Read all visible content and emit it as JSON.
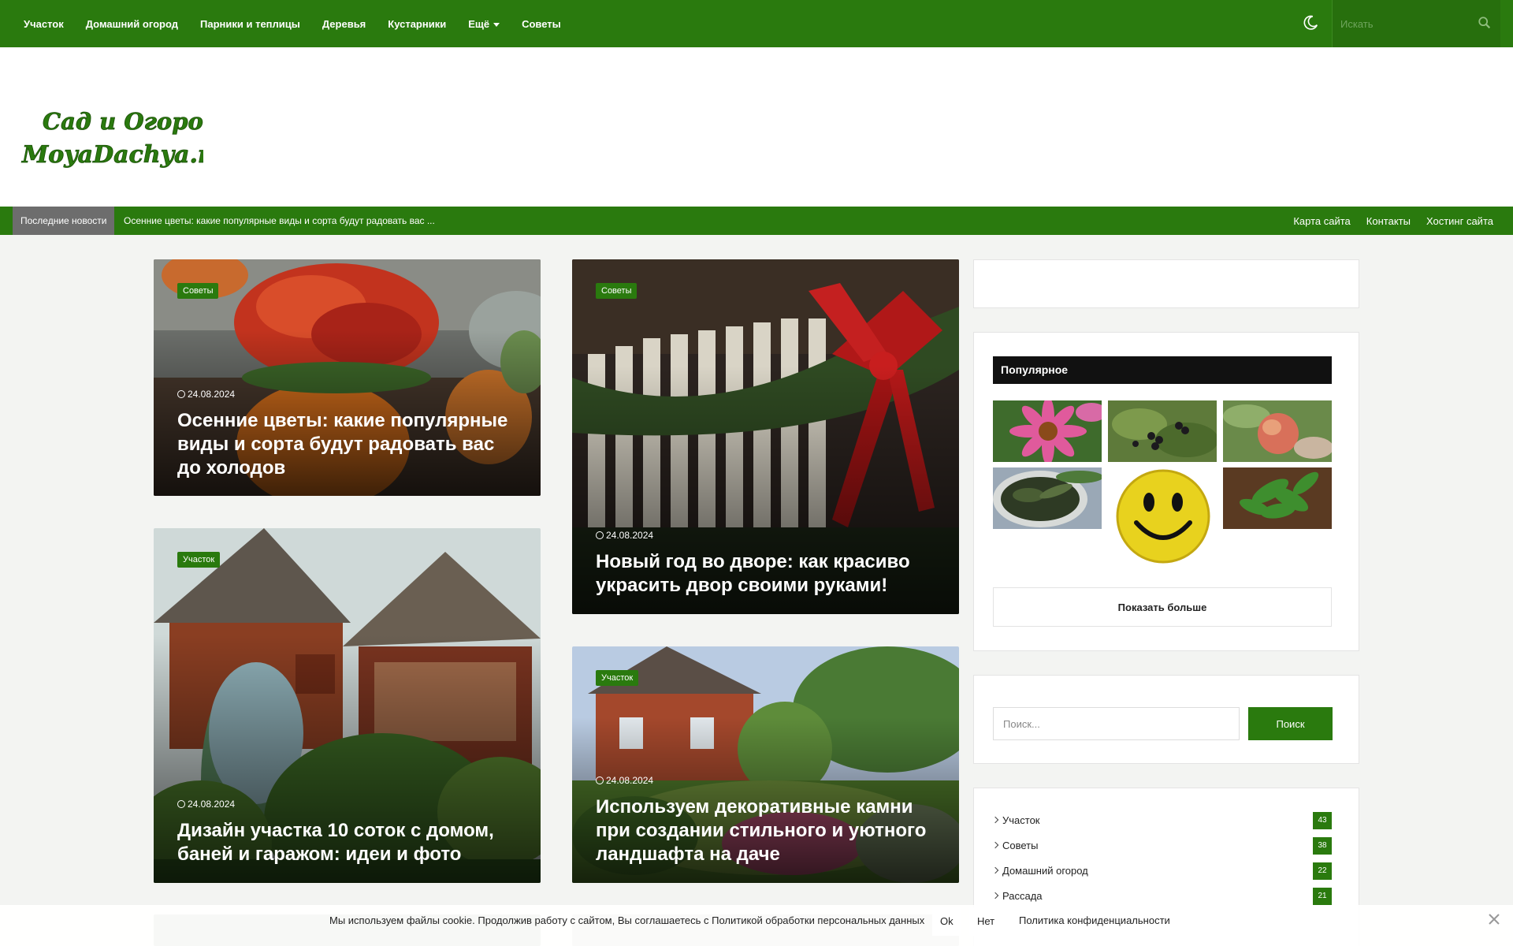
{
  "nav": {
    "items": [
      "Участок",
      "Домашний огород",
      "Парники и теплицы",
      "Деревья",
      "Кустарники",
      "Ещё",
      "Советы"
    ],
    "search_placeholder": "Искать",
    "icons": [
      "moon-icon",
      "search-icon",
      "caret-down-icon"
    ]
  },
  "logo": {
    "line1": "Сад и Огород",
    "line2": "MoyaDachya.ru"
  },
  "ticker": {
    "label": "Последние новости",
    "headline": "Осенние цветы: какие популярные виды и сорта будут радовать вас ...",
    "links": [
      "Карта сайта",
      "Контакты",
      "Хостинг сайта"
    ]
  },
  "posts": [
    {
      "category": "Советы",
      "date": "24.08.2024",
      "title": "Осенние цветы: какие популярные виды и сорта будут радовать вас до холодов"
    },
    {
      "category": "Советы",
      "date": "24.08.2024",
      "title": "Новый год во дворе: как красиво украсить двор своими руками!"
    },
    {
      "category": "Участок",
      "date": "24.08.2024",
      "title": "Дизайн участка 10 соток с домом, баней и гаражом: идеи и фото"
    },
    {
      "category": "Участок",
      "date": "24.08.2024",
      "title": "Используем декоративные камни при создании стильного и уютного ландшафта на даче"
    }
  ],
  "sidebar": {
    "popular_title": "Популярное",
    "more_button": "Показать больше",
    "search": {
      "placeholder": "Поиск...",
      "button": "Поиск"
    },
    "categories": [
      {
        "name": "Участок",
        "count": "43"
      },
      {
        "name": "Советы",
        "count": "38"
      },
      {
        "name": "Домашний огород",
        "count": "22"
      },
      {
        "name": "Рассада",
        "count": "21"
      }
    ]
  },
  "cookie": {
    "text": "Мы используем файлы cookie. Продолжив работу с сайтом, Вы соглашаетесь с Политикой обработки персональных данных",
    "ok": "Ok",
    "no": "Нет",
    "policy": "Политика конфиденциальности"
  },
  "colors": {
    "brand_green": "#2a7a0e",
    "popular_header": "#111111",
    "ticker_label": "#6d6d6d"
  }
}
